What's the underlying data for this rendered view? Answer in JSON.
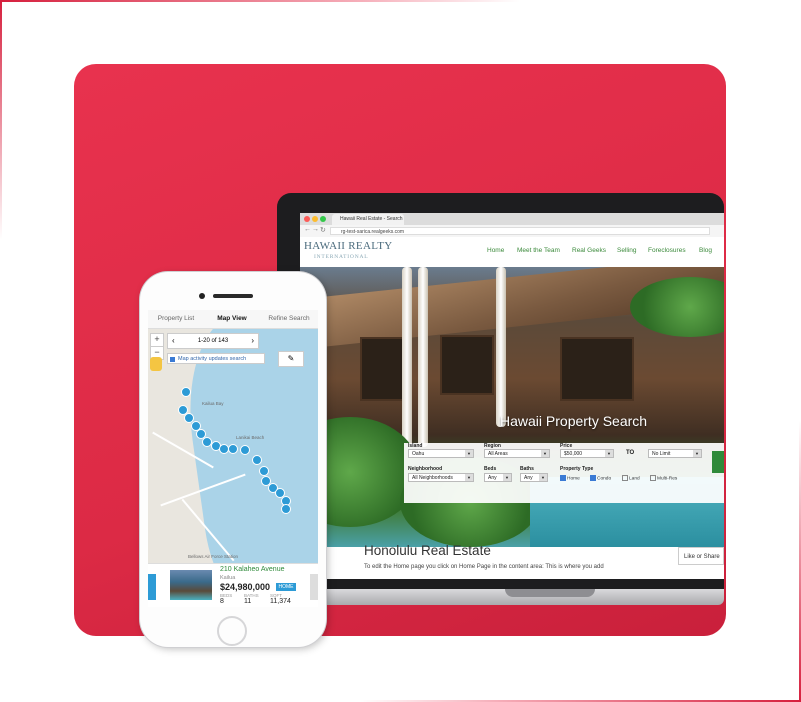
{
  "colors": {
    "panel": "#dc2a45",
    "accent_green": "#3b8a3b",
    "pin_blue": "#2d9bd6"
  },
  "browser": {
    "tab_title": "Hawaii Real Estate - Search",
    "url": "rg-test-sarica.realgeeks.com"
  },
  "site": {
    "logo_main": "HAWAII REALTY",
    "logo_sub": "INTERNATIONAL",
    "nav": [
      "Home",
      "Meet the Team",
      "Real Geeks",
      "Selling",
      "Foreclosures",
      "Blog"
    ],
    "hero_title": "Hawaii Property Search",
    "search": {
      "island_label": "Island",
      "island_value": "Oahu",
      "region_label": "Region",
      "region_value": "All Areas",
      "price_label": "Price",
      "price_min": "$50,000",
      "to": "TO",
      "price_max": "No Limit",
      "neighborhood_label": "Neighborhood",
      "neighborhood_value": "All Neighborhoods",
      "beds_label": "Beds",
      "beds_value": "Any",
      "baths_label": "Baths",
      "baths_value": "Any",
      "type_label": "Property Type",
      "types": [
        {
          "label": "Home",
          "checked": true
        },
        {
          "label": "Condo",
          "checked": true
        },
        {
          "label": "Land",
          "checked": false
        },
        {
          "label": "Multi-Res",
          "checked": false
        }
      ]
    },
    "content_heading": "Honolulu Real Estate",
    "content_text": "To edit the Home page you click on Home Page in the content area: This is where you add",
    "share_label": "Like or Share"
  },
  "phone": {
    "tabs": [
      "Property List",
      "Map View",
      "Refine Search"
    ],
    "active_tab": "Map View",
    "pager_text": "1-20 of 143",
    "map_activity": "Map activity updates search",
    "map_labels": [
      "Lanikai Beach",
      "Bellows Air Force Station",
      "Kailua Bay"
    ],
    "listing": {
      "address": "210 Kalaheo Avenue",
      "city": "Kailua",
      "price": "$24,980,000",
      "badge": "HOME",
      "beds_label": "BEDS",
      "beds": "8",
      "baths_label": "BATHS",
      "baths": "11",
      "sqft_label": "SQFT",
      "sqft": "11,374"
    }
  }
}
